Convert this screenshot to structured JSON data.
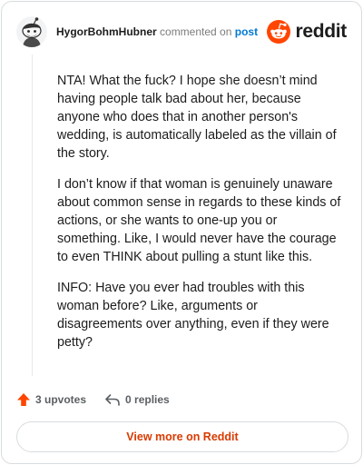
{
  "header": {
    "username": "HygorBohmHubner",
    "action_text": "commented on",
    "post_link": "post",
    "logo_text": "reddit"
  },
  "comment": {
    "paragraphs": [
      "NTA! What the fuck? I hope she doesn’t mind having people talk bad about her, because anyone who does that in another person's wedding, is automatically labeled as the villain of the story.",
      "I don’t know if that woman is genuinely unaware about common sense in regards to these kinds of actions, or she wants to one-up you or something. Like, I would never have the courage to even THINK about pulling a stunt like this.",
      "INFO: Have you ever had troubles with this woman before? Like, arguments or disagreements over anything, even if they were petty?"
    ]
  },
  "actions": {
    "upvotes_label": "3 upvotes",
    "replies_label": "0 replies"
  },
  "footer": {
    "view_more_label": "View more on Reddit"
  },
  "colors": {
    "brand": "#ff4500",
    "link": "#0079d3",
    "cta": "#d93a00"
  },
  "icons": [
    "avatar",
    "reddit-logo-icon",
    "upvote-arrow-icon",
    "reply-arrow-icon"
  ]
}
